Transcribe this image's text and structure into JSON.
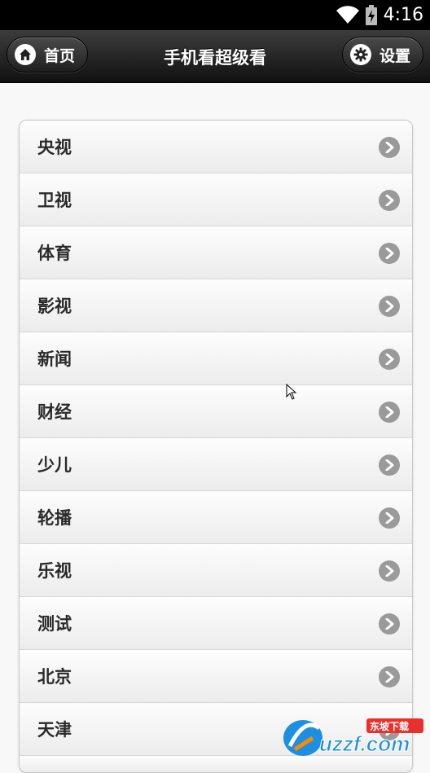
{
  "status_bar": {
    "time": "4:16",
    "wifi_icon": "wifi-icon",
    "battery_icon": "battery-charging-icon"
  },
  "header": {
    "home_label": "首页",
    "home_icon": "home-icon",
    "title": "手机看超级看",
    "settings_label": "设置",
    "settings_icon": "gear-icon"
  },
  "menu": {
    "items": [
      {
        "label": "央视"
      },
      {
        "label": "卫视"
      },
      {
        "label": "体育"
      },
      {
        "label": "影视"
      },
      {
        "label": "新闻"
      },
      {
        "label": "财经"
      },
      {
        "label": "少儿"
      },
      {
        "label": "轮播"
      },
      {
        "label": "乐视"
      },
      {
        "label": "测试"
      },
      {
        "label": "北京"
      },
      {
        "label": "天津"
      }
    ],
    "arrow_icon": "chevron-right-icon"
  },
  "watermark": {
    "text": "uzzf.com",
    "sub": "东坡下载"
  },
  "colors": {
    "header_dark": "#111111",
    "list_bg": "#f0f0f0",
    "arrow_bg": "#9a9a9a"
  }
}
